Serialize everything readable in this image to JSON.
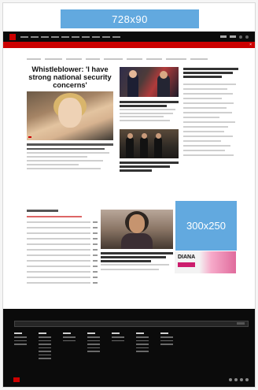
{
  "ads": {
    "top": "728x90",
    "side": "300x250",
    "diana": "DIANA"
  },
  "main": {
    "headline": "Whistleblower: 'I have strong national security concerns'"
  },
  "icons": {
    "logo": "cnn-logo-icon",
    "close": "close-icon",
    "search": "search-icon"
  },
  "colors": {
    "brand_red": "#cc0000",
    "ad_blue": "#62a9df",
    "header_bg": "#0b0b0b"
  }
}
